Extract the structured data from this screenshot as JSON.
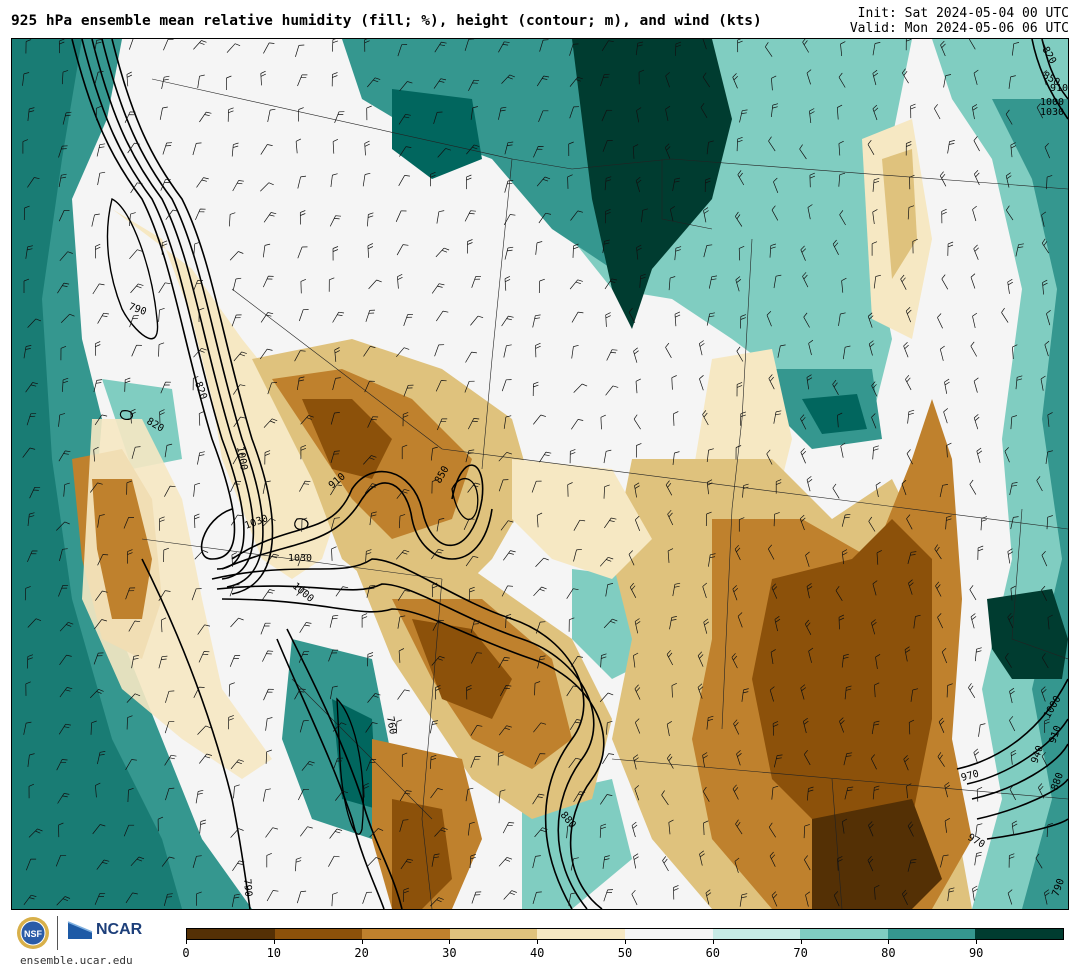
{
  "header": {
    "title": "925 hPa ensemble mean relative humidity (fill; %), height (contour; m), and wind (kts)",
    "init": "Init: Sat 2024-05-04 00 UTC",
    "valid": "Valid: Mon 2024-05-06 06 UTC"
  },
  "colors": {
    "rh_0_10": "#543005",
    "rh_10_20": "#8c510a",
    "rh_20_30": "#bf812d",
    "rh_30_40": "#dfc27d",
    "rh_40_50": "#f6e8c3",
    "rh_50_60": "#f5f5f5",
    "rh_60_70": "#c7eae5",
    "rh_70_80": "#80cdc1",
    "rh_80_90": "#35978f",
    "rh_90_100": "#01665e",
    "rh_dark": "#003c30"
  },
  "colorbar": {
    "colors": [
      "#543005",
      "#8c510a",
      "#bf812d",
      "#dfc27d",
      "#f6e8c3",
      "#f5f5f5",
      "#c7eae5",
      "#80cdc1",
      "#35978f",
      "#003c30"
    ],
    "ticks": [
      "0",
      "10",
      "20",
      "30",
      "40",
      "50",
      "60",
      "70",
      "80",
      "90"
    ]
  },
  "contour_labels": [
    {
      "text": "790"
    },
    {
      "text": "820"
    },
    {
      "text": "820"
    },
    {
      "text": "1000"
    },
    {
      "text": "1030"
    },
    {
      "text": "1030"
    },
    {
      "text": "910"
    },
    {
      "text": "850"
    },
    {
      "text": "1000"
    },
    {
      "text": "760"
    },
    {
      "text": "880"
    },
    {
      "text": "790"
    },
    {
      "text": "970"
    },
    {
      "text": "940"
    },
    {
      "text": "910"
    },
    {
      "text": "880"
    },
    {
      "text": "1000"
    },
    {
      "text": "850"
    },
    {
      "text": "820"
    },
    {
      "text": "790"
    },
    {
      "text": "1030"
    },
    {
      "text": "1000"
    },
    {
      "text": "970"
    },
    {
      "text": "910"
    }
  ],
  "footer": {
    "logo_nsf": "NSF",
    "logo_ncar": "NCAR",
    "url": "ensemble.ucar.edu"
  }
}
